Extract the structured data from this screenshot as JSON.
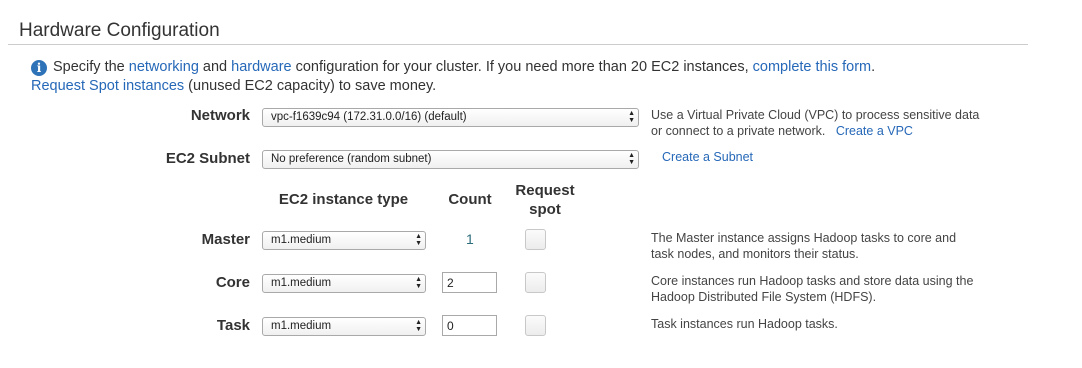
{
  "section": {
    "title": "Hardware Configuration"
  },
  "intro": {
    "icon": "info-icon",
    "accent_color": "#2e73b8",
    "text_1": "Specify the ",
    "link_networking": "networking",
    "text_2": " and ",
    "link_hardware": "hardware",
    "text_3": " configuration for your cluster. If you need more than 20 EC2 instances, ",
    "link_complete_form": "complete this form",
    "text_4": ".",
    "link_spot": "Request Spot instances",
    "text_5": " (unused EC2 capacity) to save money."
  },
  "network": {
    "label": "Network",
    "selected": "vpc-f1639c94 (172.31.0.0/16) (default)",
    "help_line1": "Use a Virtual Private Cloud (VPC) to process sensitive data",
    "help_line2": "or connect to a private network.",
    "create_link": "Create a VPC"
  },
  "subnet": {
    "label": "EC2 Subnet",
    "selected": "No preference (random subnet)",
    "create_link": "Create a Subnet"
  },
  "table_headers": {
    "instance_type": "EC2 instance type",
    "count": "Count",
    "request_spot_1": "Request",
    "request_spot_2": "spot"
  },
  "rows": {
    "master": {
      "label": "Master",
      "instance_type": "m1.medium",
      "count": "1",
      "help_line1": "The Master instance assigns Hadoop tasks to core and",
      "help_line2": "task nodes, and monitors their status."
    },
    "core": {
      "label": "Core",
      "instance_type": "m1.medium",
      "count": "2",
      "help_line1": "Core instances run Hadoop tasks and store data using the",
      "help_line2": "Hadoop Distributed File System (HDFS)."
    },
    "task": {
      "label": "Task",
      "instance_type": "m1.medium",
      "count": "0",
      "help_line1": "Task instances run Hadoop tasks."
    }
  }
}
